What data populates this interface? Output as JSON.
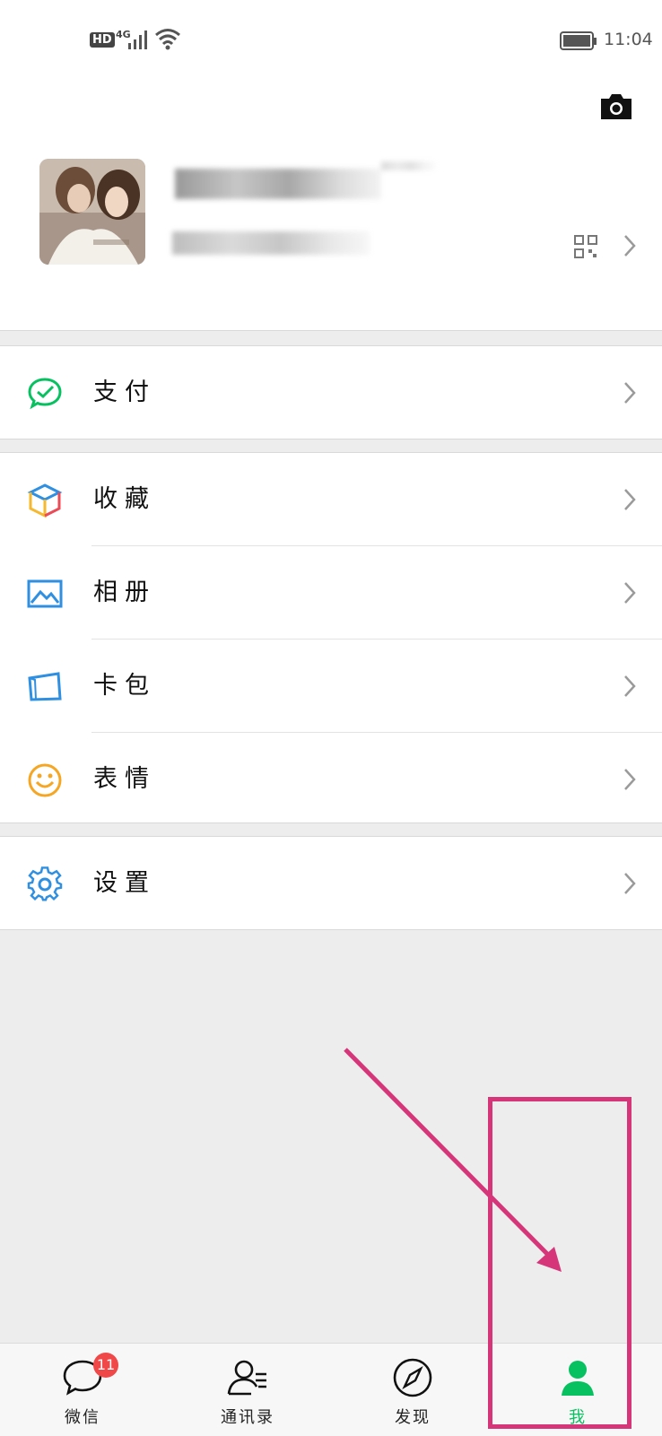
{
  "status_bar": {
    "hd": "HD",
    "network": "4G",
    "time": "11:04"
  },
  "profile": {
    "name_redacted": true
  },
  "menu": {
    "pay": "支付",
    "favorites": "收藏",
    "album": "相册",
    "cards": "卡包",
    "stickers": "表情",
    "settings": "设置"
  },
  "tabs": {
    "chats": "微信",
    "chats_badge": "11",
    "contacts": "通讯录",
    "discover": "发现",
    "me": "我"
  },
  "colors": {
    "accent_green": "#07c160",
    "badge_red": "#f04848",
    "annotation_pink": "#d6357a"
  },
  "icons": [
    "camera-icon",
    "qr-code-icon",
    "chevron-right-icon",
    "pay-icon",
    "favorites-icon",
    "album-icon",
    "card-icon",
    "emoji-icon",
    "gear-icon",
    "chat-bubble-icon",
    "contacts-icon",
    "compass-icon",
    "person-icon"
  ]
}
